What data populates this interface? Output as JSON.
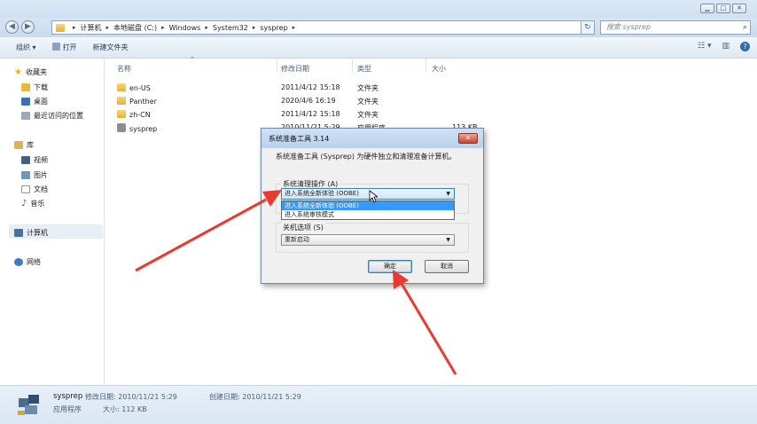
{
  "window": {
    "min_glyph": "▁",
    "max_glyph": "□",
    "close_glyph": "✕"
  },
  "address": {
    "back_glyph": "◀",
    "forward_glyph": "▶",
    "crumbs": [
      "计算机",
      "本地磁盘 (C:)",
      "Windows",
      "System32",
      "sysprep"
    ],
    "search_placeholder": "搜索 sysprep"
  },
  "toolbar": {
    "organize": "组织 ▾",
    "open": "打开",
    "new_folder": "新建文件夹"
  },
  "nav": {
    "favorites": "收藏夹",
    "downloads": "下载",
    "desktop": "桌面",
    "recent": "最近访问的位置",
    "libraries": "库",
    "videos": "视频",
    "pictures": "图片",
    "documents": "文档",
    "music": "音乐",
    "computer": "计算机",
    "network": "网络"
  },
  "list": {
    "headers": {
      "name": "名称",
      "date": "修改日期",
      "type": "类型",
      "size": "大小"
    },
    "rows": [
      {
        "name": "en-US",
        "date": "2011/4/12 15:18",
        "type": "文件夹",
        "size": ""
      },
      {
        "name": "Panther",
        "date": "2020/4/6 16:19",
        "type": "文件夹",
        "size": ""
      },
      {
        "name": "zh-CN",
        "date": "2011/4/12 15:18",
        "type": "文件夹",
        "size": ""
      },
      {
        "name": "sysprep",
        "date": "2010/11/21 5:29",
        "type": "应用程序",
        "size": "113 KB"
      }
    ]
  },
  "status": {
    "name": "sysprep",
    "modified": "修改日期: 2010/11/21 5:29",
    "created": "创建日期: 2010/11/21 5:29",
    "type": "应用程序",
    "size": "大小: 112 KB"
  },
  "dialog": {
    "title": "系统准备工具 3.14",
    "close_glyph": "✕",
    "description": "系统准备工具 (Sysprep) 为硬件独立和清理准备计算机。",
    "cleanup_label": "系统清理操作 (A)",
    "cleanup_selected": "进入系统全新体验 (OOBE)",
    "cleanup_options": [
      "进入系统全新体验 (OOBE)",
      "进入系统审核模式"
    ],
    "shutdown_label": "关机选项 (S)",
    "shutdown_selected": "重新启动",
    "ok": "确定",
    "cancel": "取消"
  }
}
